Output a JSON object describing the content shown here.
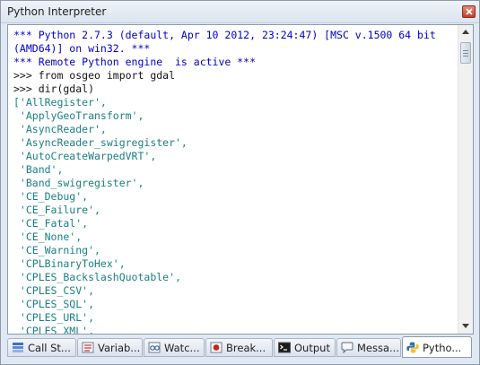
{
  "window": {
    "title": "Python Interpreter"
  },
  "console": {
    "lines": [
      {
        "text": "*** Python 2.7.3 (default, Apr 10 2012, 23:24:47) [MSC v.1500 64 bit",
        "kind": "blue"
      },
      {
        "text": "(AMD64)] on win32. ***",
        "kind": "blue"
      },
      {
        "text": "*** Remote Python engine  is active ***",
        "kind": "blue"
      },
      {
        "text": ">>> from osgeo import gdal",
        "kind": "black"
      },
      {
        "text": ">>> dir(gdal)",
        "kind": "black"
      },
      {
        "text": "['AllRegister',",
        "kind": "teal"
      },
      {
        "text": " 'ApplyGeoTransform',",
        "kind": "teal"
      },
      {
        "text": " 'AsyncReader',",
        "kind": "teal"
      },
      {
        "text": " 'AsyncReader_swigregister',",
        "kind": "teal"
      },
      {
        "text": " 'AutoCreateWarpedVRT',",
        "kind": "teal"
      },
      {
        "text": " 'Band',",
        "kind": "teal"
      },
      {
        "text": " 'Band_swigregister',",
        "kind": "teal"
      },
      {
        "text": " 'CE_Debug',",
        "kind": "teal"
      },
      {
        "text": " 'CE_Failure',",
        "kind": "teal"
      },
      {
        "text": " 'CE_Fatal',",
        "kind": "teal"
      },
      {
        "text": " 'CE_None',",
        "kind": "teal"
      },
      {
        "text": " 'CE_Warning',",
        "kind": "teal"
      },
      {
        "text": " 'CPLBinaryToHex',",
        "kind": "teal"
      },
      {
        "text": " 'CPLES_BackslashQuotable',",
        "kind": "teal"
      },
      {
        "text": " 'CPLES_CSV',",
        "kind": "teal"
      },
      {
        "text": " 'CPLES_SQL',",
        "kind": "teal"
      },
      {
        "text": " 'CPLES_URL',",
        "kind": "teal"
      },
      {
        "text": " 'CPLES_XML',",
        "kind": "teal"
      }
    ]
  },
  "tabs": [
    {
      "label": "Call St...",
      "icon": "call-stack-icon"
    },
    {
      "label": "Variab...",
      "icon": "variables-icon"
    },
    {
      "label": "Watc...",
      "icon": "watch-icon"
    },
    {
      "label": "Break...",
      "icon": "breakpoint-icon"
    },
    {
      "label": "Output",
      "icon": "output-icon"
    },
    {
      "label": "Messa...",
      "icon": "message-icon"
    },
    {
      "label": "Pytho...",
      "icon": "python-icon",
      "active": true
    }
  ],
  "colors": {
    "banner": "#0000c8",
    "input": "#141414",
    "output": "#1a7f82",
    "window_bg": "#dfe8f3"
  }
}
